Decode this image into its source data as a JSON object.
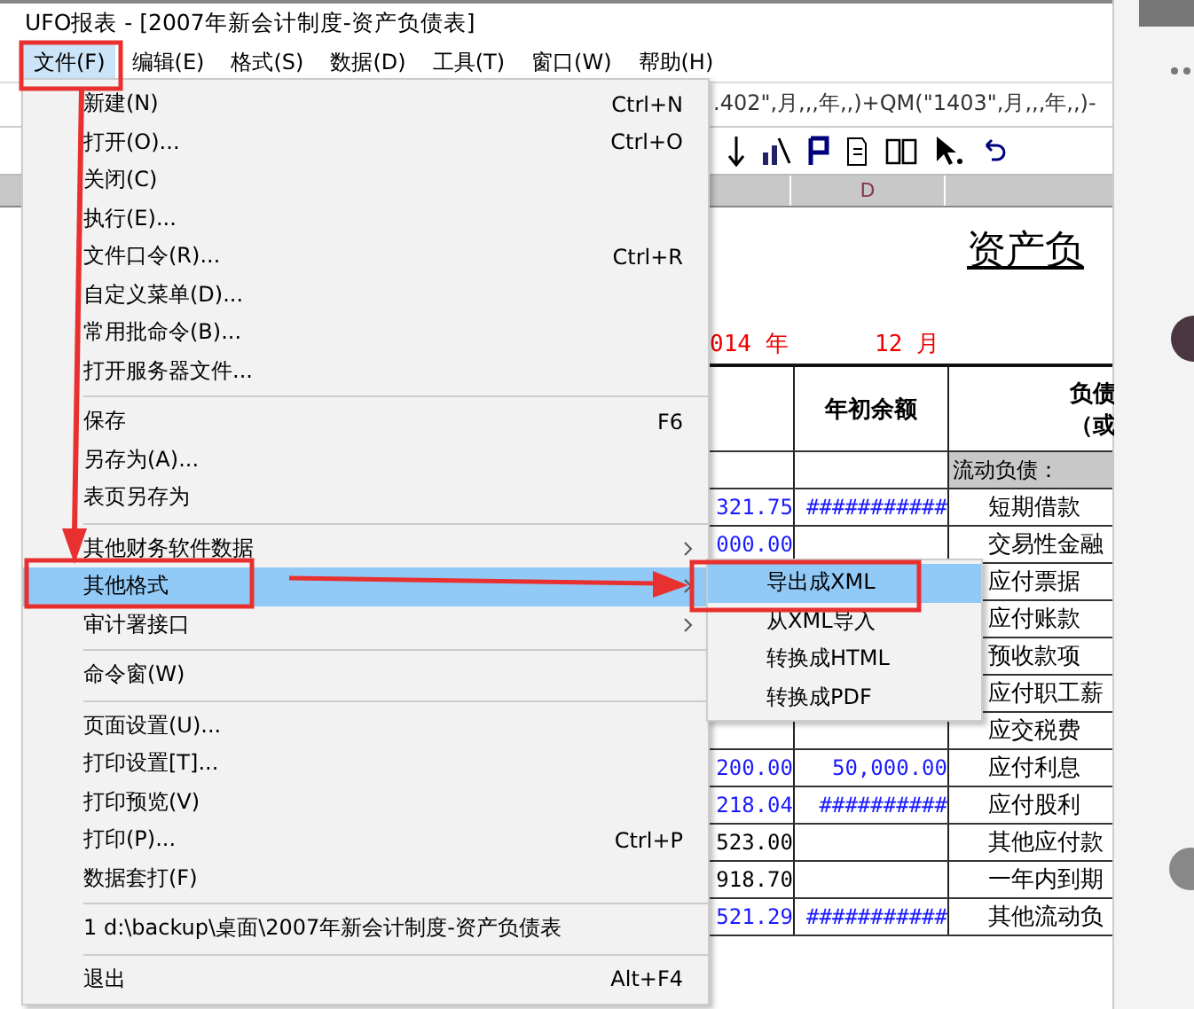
{
  "window": {
    "title": "UFO报表 - [2007年新会计制度-资产负债表]"
  },
  "menu_bar": [
    {
      "label": "文件(F)",
      "selected": true
    },
    {
      "label": "编辑(E)",
      "selected": false
    },
    {
      "label": "格式(S)",
      "selected": false
    },
    {
      "label": "数据(D)",
      "selected": false
    },
    {
      "label": "工具(T)",
      "selected": false
    },
    {
      "label": "窗口(W)",
      "selected": false
    },
    {
      "label": "帮助(H)",
      "selected": false
    }
  ],
  "formula_bar": {
    "value": ".402\",月,,,年,,)+QM(\"1403\",月,,,年,,)-"
  },
  "column_headers": [
    "D"
  ],
  "sheet": {
    "title": "资产负",
    "year": "014 年",
    "month": "12 月",
    "header": {
      "column_d": "年初余额",
      "column_e_line_1": "负债",
      "column_e_line_2": "（或"
    },
    "rows": [
      {
        "kind": "section",
        "column_e": "流动负债："
      },
      {
        "kind": "data",
        "column_c": "321.75",
        "c_formula": true,
        "column_d": "###########",
        "column_e": "短期借款"
      },
      {
        "kind": "data",
        "column_c": "000.00",
        "c_formula": true,
        "column_e": "交易性金融"
      },
      {
        "kind": "data",
        "column_e": "应付票据"
      },
      {
        "kind": "data",
        "column_e": "应付账款"
      },
      {
        "kind": "data",
        "column_e": "预收款项"
      },
      {
        "kind": "data",
        "column_e": "应付职工薪"
      },
      {
        "kind": "data",
        "column_e": "应交税费"
      },
      {
        "kind": "data",
        "column_c": "200.00",
        "c_formula": true,
        "column_d": "50,000.00",
        "column_e": "应付利息"
      },
      {
        "kind": "data",
        "column_c": "218.04",
        "c_formula": true,
        "column_d": "##########",
        "column_e": "应付股利"
      },
      {
        "kind": "data",
        "column_c": "523.00",
        "c_formula": false,
        "column_e": "其他应付款"
      },
      {
        "kind": "data",
        "column_c": "918.70",
        "c_formula": false,
        "column_e": "一年内到期"
      },
      {
        "kind": "data",
        "column_c": "521.29",
        "c_formula": true,
        "column_d": "###########",
        "column_e": "其他流动负"
      }
    ]
  },
  "file_menu": {
    "items": [
      {
        "kind": "item",
        "label": "新建(N)",
        "shortcut": "Ctrl+N",
        "has_submenu": false,
        "selected": false
      },
      {
        "kind": "item",
        "label": "打开(O)...",
        "shortcut": "Ctrl+O",
        "has_submenu": false,
        "selected": false
      },
      {
        "kind": "item",
        "label": "关闭(C)",
        "has_submenu": false,
        "selected": false
      },
      {
        "kind": "item",
        "label": "执行(E)...",
        "has_submenu": false,
        "selected": false
      },
      {
        "kind": "item",
        "label": "文件口令(R)...",
        "shortcut": "Ctrl+R",
        "has_submenu": false,
        "selected": false
      },
      {
        "kind": "item",
        "label": "自定义菜单(D)...",
        "has_submenu": false,
        "selected": false
      },
      {
        "kind": "item",
        "label": "常用批命令(B)...",
        "has_submenu": false,
        "selected": false
      },
      {
        "kind": "item",
        "label": "打开服务器文件...",
        "has_submenu": false,
        "selected": false
      },
      {
        "kind": "separator"
      },
      {
        "kind": "item",
        "label": "保存",
        "shortcut": "F6",
        "has_submenu": false,
        "selected": false
      },
      {
        "kind": "item",
        "label": "另存为(A)...",
        "has_submenu": false,
        "selected": false
      },
      {
        "kind": "item",
        "label": "表页另存为",
        "has_submenu": false,
        "selected": false
      },
      {
        "kind": "separator"
      },
      {
        "kind": "item",
        "label": "其他财务软件数据",
        "has_submenu": true,
        "selected": false
      },
      {
        "kind": "item",
        "label": "其他格式",
        "has_submenu": true,
        "selected": true
      },
      {
        "kind": "item",
        "label": "审计署接口",
        "has_submenu": true,
        "selected": false
      },
      {
        "kind": "separator"
      },
      {
        "kind": "item",
        "label": "命令窗(W)",
        "has_submenu": false,
        "selected": false
      },
      {
        "kind": "separator"
      },
      {
        "kind": "item",
        "label": "页面设置(U)...",
        "has_submenu": false,
        "selected": false
      },
      {
        "kind": "item",
        "label": "打印设置[T]...",
        "has_submenu": false,
        "selected": false
      },
      {
        "kind": "item",
        "label": "打印预览(V)",
        "has_submenu": false,
        "selected": false
      },
      {
        "kind": "item",
        "label": "打印(P)...",
        "shortcut": "Ctrl+P",
        "has_submenu": false,
        "selected": false
      },
      {
        "kind": "item",
        "label": "数据套打(F)",
        "has_submenu": false,
        "selected": false
      },
      {
        "kind": "separator"
      },
      {
        "kind": "item",
        "label": "1 d:\\backup\\桌面\\2007年新会计制度-资产负债表",
        "has_submenu": false,
        "selected": false
      },
      {
        "kind": "separator"
      },
      {
        "kind": "item",
        "label": "退出",
        "shortcut": "Alt+F4",
        "has_submenu": false,
        "selected": false
      }
    ]
  },
  "submenu": {
    "items": [
      {
        "label": "导出成XML",
        "selected": true
      },
      {
        "label": "从XML导入",
        "selected": false
      },
      {
        "label": "转换成HTML",
        "selected": false
      },
      {
        "label": "转换成PDF",
        "selected": false
      }
    ]
  }
}
